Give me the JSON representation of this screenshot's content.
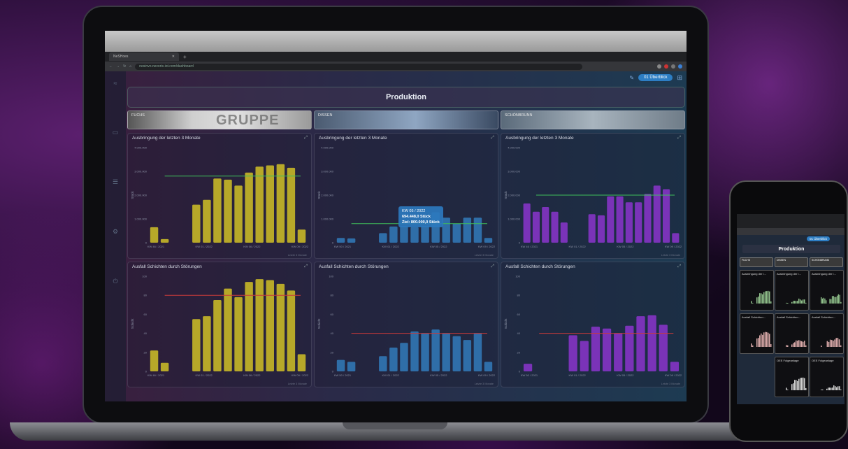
{
  "browser": {
    "tab_title": "NeSHoes",
    "url": "nesinvo.nexoris-iot.com/dashboard"
  },
  "app": {
    "overview_button": "01 Überblick",
    "page_title": "Produktion",
    "plants": [
      {
        "name": "FUCHS",
        "overlay": "GRUPPE"
      },
      {
        "name": "DISSEN",
        "overlay": ""
      },
      {
        "name": "SCHÖNBRUNN",
        "overlay": ""
      }
    ],
    "panels": {
      "output_title": "Ausbringung der letzten 3 Monate",
      "downtime_title": "Ausfall Schichten durch Störungen",
      "footer": "Letzte 3 Monate"
    },
    "tooltip": {
      "week": "KW 05 / 2022",
      "value": "694.448,0 Stück",
      "target": "Ziel: 800.000,0 Stück"
    }
  },
  "phone": {
    "page_title": "Produktion",
    "overview_button": "01 Überblick",
    "plants": [
      "FUCHS",
      "DISSEN",
      "SCHÖNBRUNN"
    ],
    "card_titles": [
      "Ausbringung der l…",
      "Ausbringung der l…",
      "Ausbringung der l…",
      "Ausfall Schichten…",
      "Ausfall Schichten…",
      "Ausfall Schichten…",
      "OEE Folgeanlage",
      "OEE Folgeanlage"
    ]
  },
  "chart_data": [
    {
      "type": "bar",
      "title": "Ausbringung der letzten 3 Monate",
      "plant": "FUCHS",
      "ylabel": "Stück",
      "ylim": [
        0,
        4000000
      ],
      "yticks": [
        "0",
        "1.000.000",
        "2.000.000",
        "3.000.000",
        "4.000.000"
      ],
      "xticks": [
        "KW 46 / 2021",
        "KW 01 / 2022",
        "KW 06 / 2022",
        "KW 09 / 2022"
      ],
      "values": [
        650000,
        150000,
        0,
        0,
        1600000,
        1800000,
        2700000,
        2650000,
        2400000,
        2950000,
        3200000,
        3250000,
        3300000,
        3150000,
        550000
      ],
      "target": 2800000,
      "color": "#b7a829",
      "target_color": "#3fbf5a"
    },
    {
      "type": "bar",
      "title": "Ausbringung der letzten 3 Monate",
      "plant": "DISSEN",
      "ylabel": "Stück",
      "ylim": [
        0,
        4000000
      ],
      "yticks": [
        "0",
        "1.000.000",
        "2.000.000",
        "3.000.000",
        "4.000.000"
      ],
      "xticks": [
        "KW 50 / 2021",
        "KW 01 / 2022",
        "KW 05 / 2022",
        "KW 09 / 2022"
      ],
      "values": [
        200000,
        180000,
        0,
        0,
        400000,
        680000,
        700000,
        650000,
        700000,
        1280000,
        1050000,
        800000,
        1050000,
        1050000,
        200000
      ],
      "target": 800000,
      "color": "#2f6ea8",
      "target_color": "#3fbf5a"
    },
    {
      "type": "bar",
      "title": "Ausbringung der letzten 3 Monate",
      "plant": "SCHÖNBRUNN",
      "ylabel": "Stück",
      "ylim": [
        0,
        4000000
      ],
      "yticks": [
        "0",
        "1.000.000",
        "2.000.000",
        "3.000.000",
        "4.000.000"
      ],
      "xticks": [
        "KW 46 / 2021",
        "KW 01 / 2022",
        "KW 05 / 2022",
        "KW 09 / 2022"
      ],
      "values": [
        1650000,
        1300000,
        1500000,
        1300000,
        850000,
        0,
        0,
        1200000,
        1150000,
        1950000,
        1950000,
        1700000,
        1700000,
        2050000,
        2400000,
        2250000,
        400000
      ],
      "target": 2000000,
      "color": "#7a33b8",
      "target_color": "#3fbf5a"
    },
    {
      "type": "bar",
      "title": "Ausfall Schichten durch Störungen",
      "plant": "FUCHS",
      "ylabel": "Schicht",
      "ylim": [
        0,
        100
      ],
      "yticks": [
        "0",
        "20",
        "40",
        "60",
        "80",
        "100"
      ],
      "xticks": [
        "KW 46 / 2021",
        "KW 01 / 2022",
        "KW 06 / 2022",
        "KW 09 / 2022"
      ],
      "values": [
        22,
        9,
        0,
        0,
        55,
        58,
        75,
        87,
        78,
        94,
        97,
        96,
        92,
        85,
        18
      ],
      "target": 80,
      "color": "#b7a829",
      "target_color": "#c83a3a"
    },
    {
      "type": "bar",
      "title": "Ausfall Schichten durch Störungen",
      "plant": "DISSEN",
      "ylabel": "Schicht",
      "ylim": [
        0,
        100
      ],
      "yticks": [
        "0",
        "20",
        "40",
        "60",
        "80",
        "100"
      ],
      "xticks": [
        "KW 50 / 2021",
        "KW 01 / 2022",
        "KW 05 / 2022",
        "KW 09 / 2022"
      ],
      "values": [
        12,
        10,
        0,
        0,
        16,
        25,
        30,
        42,
        40,
        44,
        40,
        37,
        33,
        40,
        10
      ],
      "target": 40,
      "color": "#2f6ea8",
      "target_color": "#c83a3a"
    },
    {
      "type": "bar",
      "title": "Ausfall Schichten durch Störungen",
      "plant": "SCHÖNBRUNN",
      "ylabel": "Schicht",
      "ylim": [
        0,
        100
      ],
      "yticks": [
        "0",
        "20",
        "40",
        "60",
        "80",
        "100"
      ],
      "xticks": [
        "KW 50 / 2021",
        "KW 01 / 2022",
        "KW 05 / 2022",
        "KW 09 / 2022"
      ],
      "values": [
        8,
        0,
        0,
        0,
        38,
        32,
        47,
        45,
        40,
        48,
        58,
        59,
        49,
        10
      ],
      "target": 40,
      "color": "#7a33b8",
      "target_color": "#c83a3a"
    }
  ]
}
